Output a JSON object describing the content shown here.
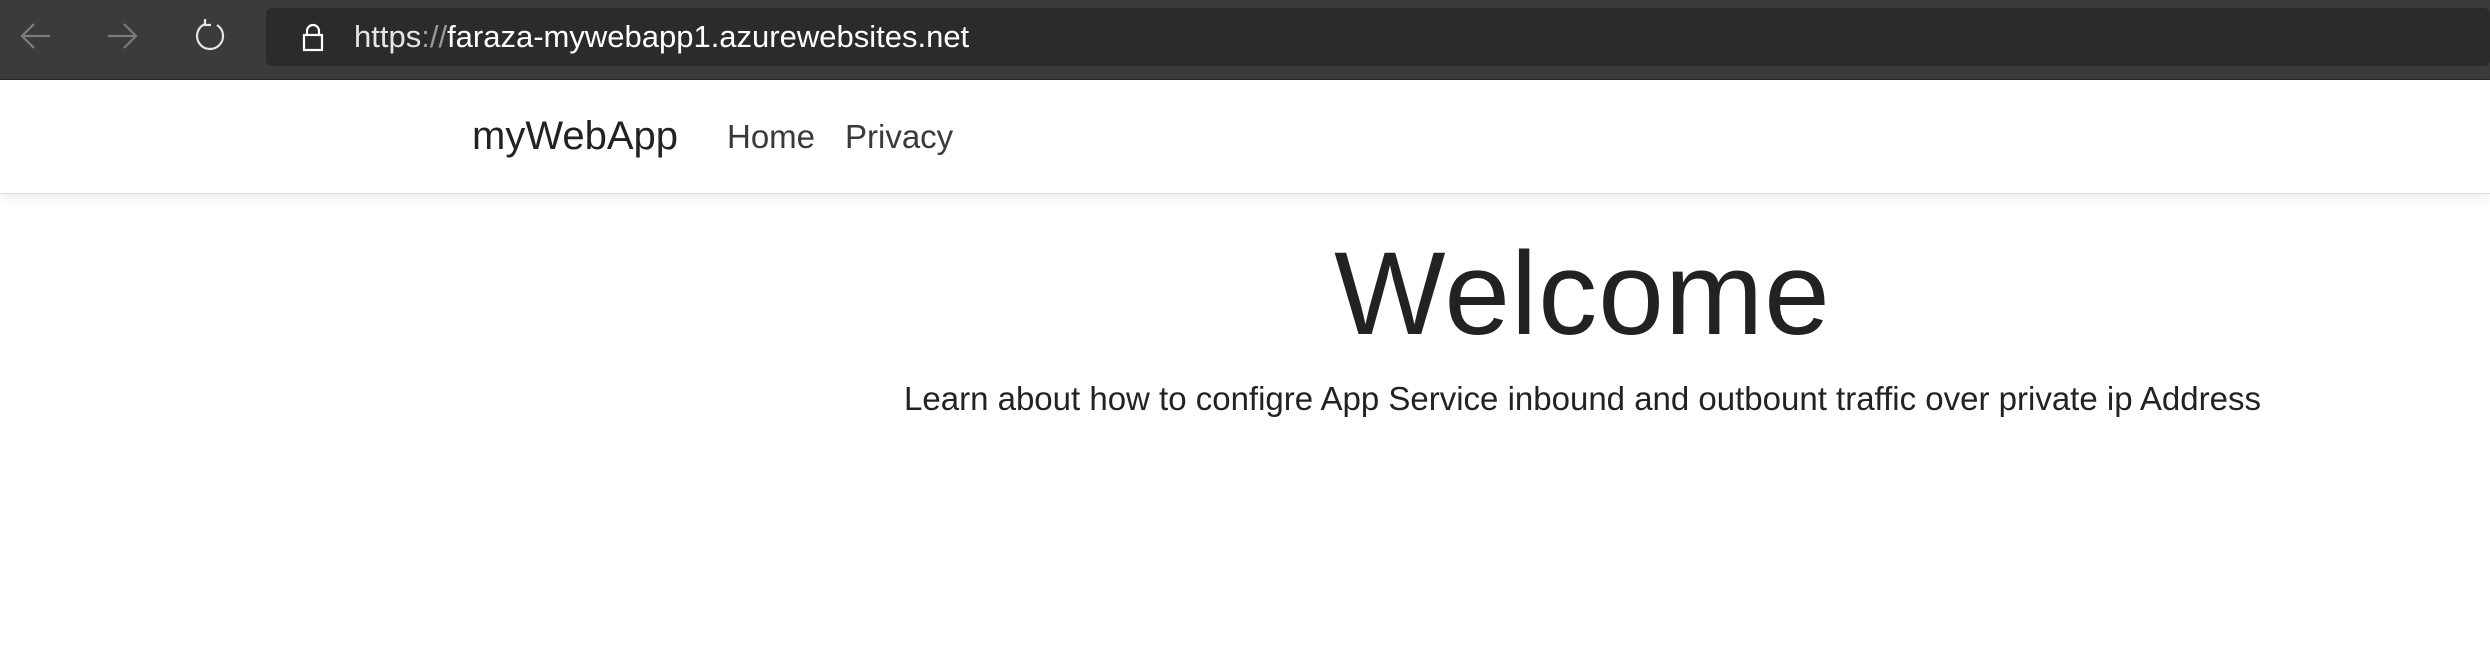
{
  "browser": {
    "url_scheme": "https",
    "url_separator": "://",
    "url_host": "faraza-mywebapp1.azurewebsites.net",
    "icons": [
      "back-arrow-icon",
      "forward-arrow-icon",
      "refresh-icon",
      "lock-icon"
    ]
  },
  "site_nav": {
    "brand": "myWebApp",
    "links": [
      {
        "label": "Home"
      },
      {
        "label": "Privacy"
      }
    ]
  },
  "main": {
    "heading": "Welcome",
    "lead": "Learn about how to configre App Service inbound and outbount traffic over private ip Address"
  },
  "colors": {
    "browser_bar": "#3b3b3b",
    "address_bar": "#2b2b2b",
    "text_dark": "#222222"
  }
}
